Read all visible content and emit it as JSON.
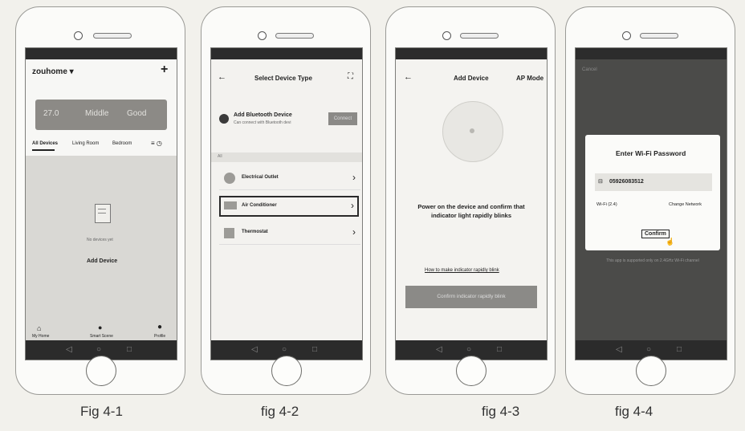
{
  "captions": [
    "Fig 4-1",
    "fig 4-2",
    "fig 4-3",
    "fig 4-4"
  ],
  "fig1": {
    "home_name": "zouhome ▾",
    "plus": "+",
    "weather": [
      "27.0",
      "Middle",
      "Good"
    ],
    "tabs": [
      "All Devices",
      "Living Room",
      "Bedroom"
    ],
    "no_device": "No devices yet",
    "add_device": "Add Device",
    "bottom_nav": [
      "My Home",
      "Smart Scene",
      "Profile"
    ]
  },
  "fig2": {
    "back": "←",
    "title": "Select Device Type",
    "scan": "⛶",
    "bt_title": "Add Bluetooth Device",
    "bt_sub": "Can connect with Bluetooth devi",
    "bt_button": "Connect",
    "section": "All",
    "items": [
      "Electrical Outlet",
      "Air Conditioner",
      "Thermostat"
    ],
    "chevron": "›"
  },
  "fig3": {
    "back": "←",
    "title": "Add Device",
    "mode": "AP Mode",
    "instruction": "Power on the device and confirm that indicator light rapidly blinks",
    "link": "How to make indicator rapidly blink",
    "button": "Confirm indicator rapidly blink"
  },
  "fig4": {
    "cancel": "Cancel",
    "dialog_title": "Enter Wi-Fi Password",
    "password": "05926083512",
    "wifi": "Wi-Fi (2.4)",
    "change": "Change Network",
    "confirm": "Confirm",
    "note": "This app is supported only on 2.4GHz Wi-Fi channel"
  },
  "nav_symbols": [
    "◁",
    "○",
    "□"
  ],
  "colors": {
    "outline": "#2a2a2a",
    "grey_button": "#8b8a87",
    "dark_screen": "#4b4b49"
  }
}
